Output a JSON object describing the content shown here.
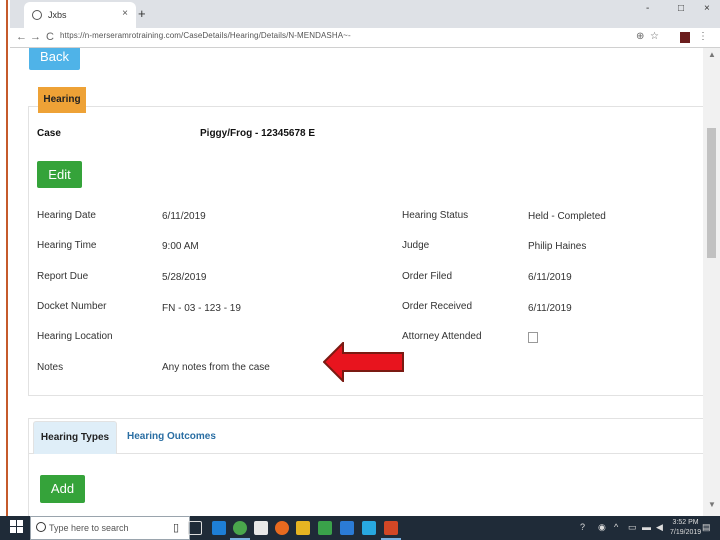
{
  "browser": {
    "tab_title": "Jxbs",
    "tab_close": "×",
    "new_tab": "+",
    "window_controls": {
      "minimize": "-",
      "maximize": "□",
      "close": "×"
    },
    "nav": {
      "back": "←",
      "forward": "→",
      "reload": "C"
    },
    "url": "https://n-merseramrotraining.com/CaseDetails/Hearing/Details/N-MENDASHA~-",
    "tools": {
      "zoom": "⊕",
      "star": "☆",
      "menu": "⋮"
    }
  },
  "page": {
    "back_label": "Back",
    "panel_title": "Hearing",
    "case_label": "Case",
    "case_value": "Piggy/Frog - 12345678 E",
    "edit_label": "Edit",
    "fields_left": [
      {
        "label": "Hearing Date",
        "value": "6/11/2019"
      },
      {
        "label": "Hearing Time",
        "value": "9:00 AM"
      },
      {
        "label": "Report Due",
        "value": "5/28/2019"
      },
      {
        "label": "Docket Number",
        "value": "FN - 03 - 123 - 19"
      },
      {
        "label": "Hearing Location",
        "value": ""
      },
      {
        "label": "Notes",
        "value": "Any notes from the case"
      }
    ],
    "fields_right": [
      {
        "label": "Hearing Status",
        "value": "Held - Completed"
      },
      {
        "label": "Judge",
        "value": "Philip Haines"
      },
      {
        "label": "Order Filed",
        "value": "6/11/2019"
      },
      {
        "label": "Order Received",
        "value": "6/11/2019"
      },
      {
        "label": "Attorney Attended",
        "value": ""
      }
    ],
    "attorney_attended_checked": false,
    "tabs": [
      {
        "label": "Hearing Types",
        "active": true
      },
      {
        "label": "Hearing Outcomes",
        "active": false
      }
    ],
    "add_label": "Add"
  },
  "annotation": {
    "arrow_color": "#e8141e",
    "arrow_outline": "#7a1a12"
  },
  "taskbar": {
    "search_placeholder": "Type here to search",
    "time": "3:52 PM",
    "date": "7/19/2019"
  },
  "colors": {
    "back_button": "#4fb3e8",
    "hearing_tag": "#eea236",
    "green_button": "#35a33a",
    "tab_active_bg": "#dfeef8",
    "tab_link": "#2a6ea3",
    "taskbar_bg": "#1f2b38"
  }
}
